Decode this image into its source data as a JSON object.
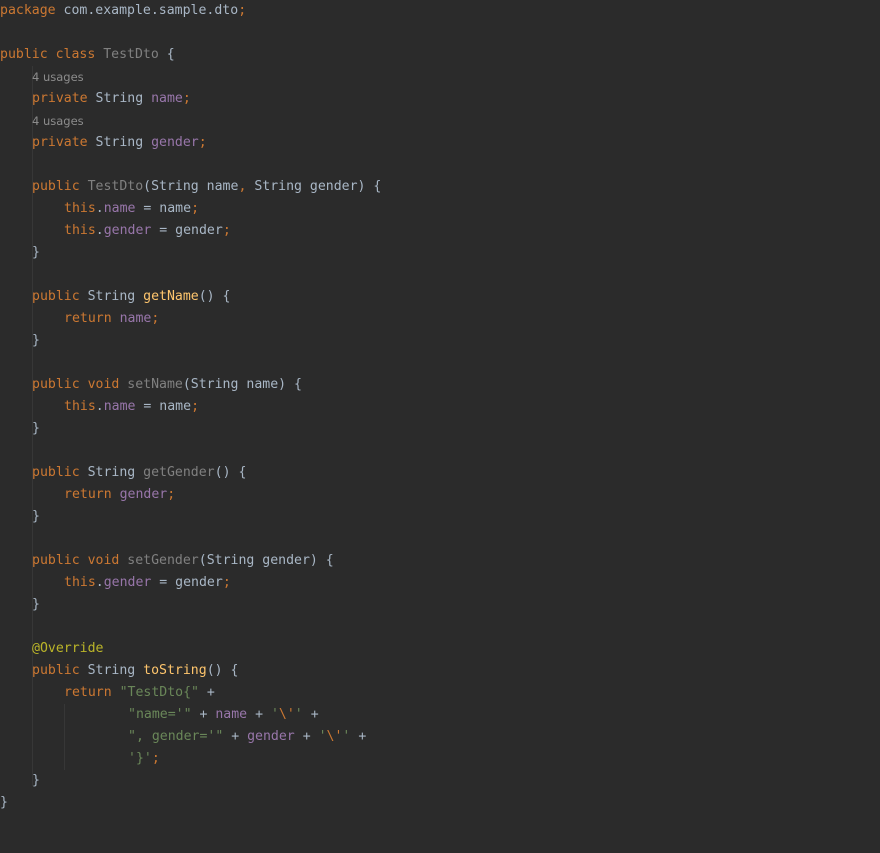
{
  "file": {
    "language": "java",
    "package_line": [
      "package",
      "com.example.sample.dto",
      ";"
    ],
    "class_header": [
      "public",
      "class",
      "TestDto",
      "{"
    ],
    "usage_hint": "4 usages"
  },
  "lines": [
    [
      {
        "t": "package",
        "c": "kw"
      },
      {
        "t": " com.example.sample.dto",
        "c": "plain"
      },
      {
        "t": ";",
        "c": "pun"
      }
    ],
    [],
    [
      {
        "t": "public class ",
        "c": "kw"
      },
      {
        "t": "TestDto",
        "c": "gray"
      },
      {
        "t": " {",
        "c": "plain"
      }
    ],
    [
      {
        "t": "4 usages",
        "c": "usage"
      }
    ],
    [
      {
        "t": "private ",
        "c": "kw"
      },
      {
        "t": "String ",
        "c": "plain"
      },
      {
        "t": "name",
        "c": "fld"
      },
      {
        "t": ";",
        "c": "pun"
      }
    ],
    [
      {
        "t": "4 usages",
        "c": "usage"
      }
    ],
    [
      {
        "t": "private ",
        "c": "kw"
      },
      {
        "t": "String ",
        "c": "plain"
      },
      {
        "t": "gender",
        "c": "fld"
      },
      {
        "t": ";",
        "c": "pun"
      }
    ],
    [],
    [
      {
        "t": "public ",
        "c": "kw"
      },
      {
        "t": "TestDto",
        "c": "gray"
      },
      {
        "t": "(String name",
        "c": "plain"
      },
      {
        "t": ", ",
        "c": "pun"
      },
      {
        "t": "String gender) {",
        "c": "plain"
      }
    ],
    [
      {
        "t": "this",
        "c": "kw"
      },
      {
        "t": ".",
        "c": "plain"
      },
      {
        "t": "name",
        "c": "fld"
      },
      {
        "t": " = name",
        "c": "plain"
      },
      {
        "t": ";",
        "c": "pun"
      }
    ],
    [
      {
        "t": "this",
        "c": "kw"
      },
      {
        "t": ".",
        "c": "plain"
      },
      {
        "t": "gender",
        "c": "fld"
      },
      {
        "t": " = gender",
        "c": "plain"
      },
      {
        "t": ";",
        "c": "pun"
      }
    ],
    [
      {
        "t": "}",
        "c": "plain"
      }
    ],
    [],
    [
      {
        "t": "public ",
        "c": "kw"
      },
      {
        "t": "String ",
        "c": "plain"
      },
      {
        "t": "getName",
        "c": "fn"
      },
      {
        "t": "() {",
        "c": "plain"
      }
    ],
    [
      {
        "t": "return ",
        "c": "kw"
      },
      {
        "t": "name",
        "c": "fld"
      },
      {
        "t": ";",
        "c": "pun"
      }
    ],
    [
      {
        "t": "}",
        "c": "plain"
      }
    ],
    [],
    [
      {
        "t": "public void ",
        "c": "kw"
      },
      {
        "t": "setName",
        "c": "gray"
      },
      {
        "t": "(String name) {",
        "c": "plain"
      }
    ],
    [
      {
        "t": "this",
        "c": "kw"
      },
      {
        "t": ".",
        "c": "plain"
      },
      {
        "t": "name",
        "c": "fld"
      },
      {
        "t": " = name",
        "c": "plain"
      },
      {
        "t": ";",
        "c": "pun"
      }
    ],
    [
      {
        "t": "}",
        "c": "plain"
      }
    ],
    [],
    [
      {
        "t": "public ",
        "c": "kw"
      },
      {
        "t": "String ",
        "c": "plain"
      },
      {
        "t": "getGender",
        "c": "gray"
      },
      {
        "t": "() {",
        "c": "plain"
      }
    ],
    [
      {
        "t": "return ",
        "c": "kw"
      },
      {
        "t": "gender",
        "c": "fld"
      },
      {
        "t": ";",
        "c": "pun"
      }
    ],
    [
      {
        "t": "}",
        "c": "plain"
      }
    ],
    [],
    [
      {
        "t": "public void ",
        "c": "kw"
      },
      {
        "t": "setGender",
        "c": "gray"
      },
      {
        "t": "(String gender) {",
        "c": "plain"
      }
    ],
    [
      {
        "t": "this",
        "c": "kw"
      },
      {
        "t": ".",
        "c": "plain"
      },
      {
        "t": "gender",
        "c": "fld"
      },
      {
        "t": " = gender",
        "c": "plain"
      },
      {
        "t": ";",
        "c": "pun"
      }
    ],
    [
      {
        "t": "}",
        "c": "plain"
      }
    ],
    [],
    [
      {
        "t": "@Override",
        "c": "ann"
      }
    ],
    [
      {
        "t": "public ",
        "c": "kw"
      },
      {
        "t": "String ",
        "c": "plain"
      },
      {
        "t": "toString",
        "c": "fn"
      },
      {
        "t": "() {",
        "c": "plain"
      }
    ],
    [
      {
        "t": "return ",
        "c": "kw"
      },
      {
        "t": "\"TestDto{\"",
        "c": "str"
      },
      {
        "t": " +",
        "c": "plain"
      }
    ],
    [
      {
        "t": "\"name='\"",
        "c": "str"
      },
      {
        "t": " + ",
        "c": "plain"
      },
      {
        "t": "name",
        "c": "fld"
      },
      {
        "t": " + ",
        "c": "plain"
      },
      {
        "t": "'",
        "c": "str"
      },
      {
        "t": "\\'",
        "c": "esc"
      },
      {
        "t": "'",
        "c": "str"
      },
      {
        "t": " +",
        "c": "plain"
      }
    ],
    [
      {
        "t": "\", gender='\"",
        "c": "str"
      },
      {
        "t": " + ",
        "c": "plain"
      },
      {
        "t": "gender",
        "c": "fld"
      },
      {
        "t": " + ",
        "c": "plain"
      },
      {
        "t": "'",
        "c": "str"
      },
      {
        "t": "\\'",
        "c": "esc"
      },
      {
        "t": "'",
        "c": "str"
      },
      {
        "t": " +",
        "c": "plain"
      }
    ],
    [
      {
        "t": "'}'",
        "c": "str"
      },
      {
        "t": ";",
        "c": "pun"
      }
    ],
    [
      {
        "t": "}",
        "c": "plain"
      }
    ],
    [
      {
        "t": "}",
        "c": "plain"
      }
    ]
  ],
  "indent": [
    0,
    0,
    0,
    1,
    1,
    1,
    1,
    0,
    1,
    2,
    2,
    1,
    0,
    1,
    2,
    1,
    0,
    1,
    2,
    1,
    0,
    1,
    2,
    1,
    0,
    1,
    2,
    1,
    0,
    1,
    1,
    2,
    4,
    4,
    4,
    1,
    0
  ]
}
